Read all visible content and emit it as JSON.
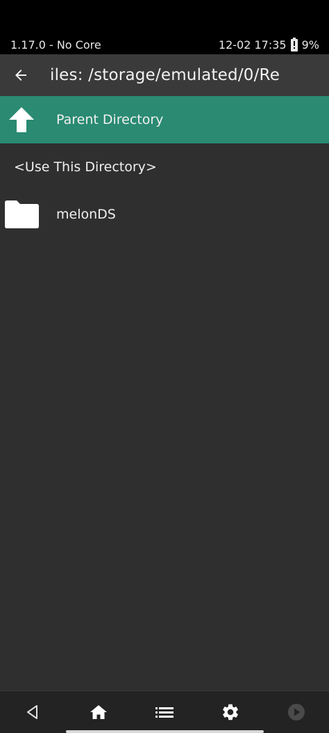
{
  "status_bar": {
    "left_text": "1.17.0 - No Core",
    "time": "12-02 17:35",
    "battery": "9%"
  },
  "title_bar": {
    "title": "iles: /storage/emulated/0/Re"
  },
  "list": {
    "items": [
      {
        "label": "Parent Directory",
        "icon": "arrow-up-icon",
        "selected": true
      },
      {
        "label": "<Use This Directory>",
        "icon": "",
        "selected": false
      },
      {
        "label": "melonDS",
        "icon": "folder-icon",
        "selected": false
      }
    ]
  },
  "bottom_nav": {
    "items": [
      "back-triangle-icon",
      "home-icon",
      "list-icon",
      "gear-icon",
      "play-icon"
    ]
  },
  "colors": {
    "accent": "#2a8a72",
    "background": "#2f2f2f",
    "title_bar": "#3a3a3a",
    "nav_bar": "#232323"
  }
}
